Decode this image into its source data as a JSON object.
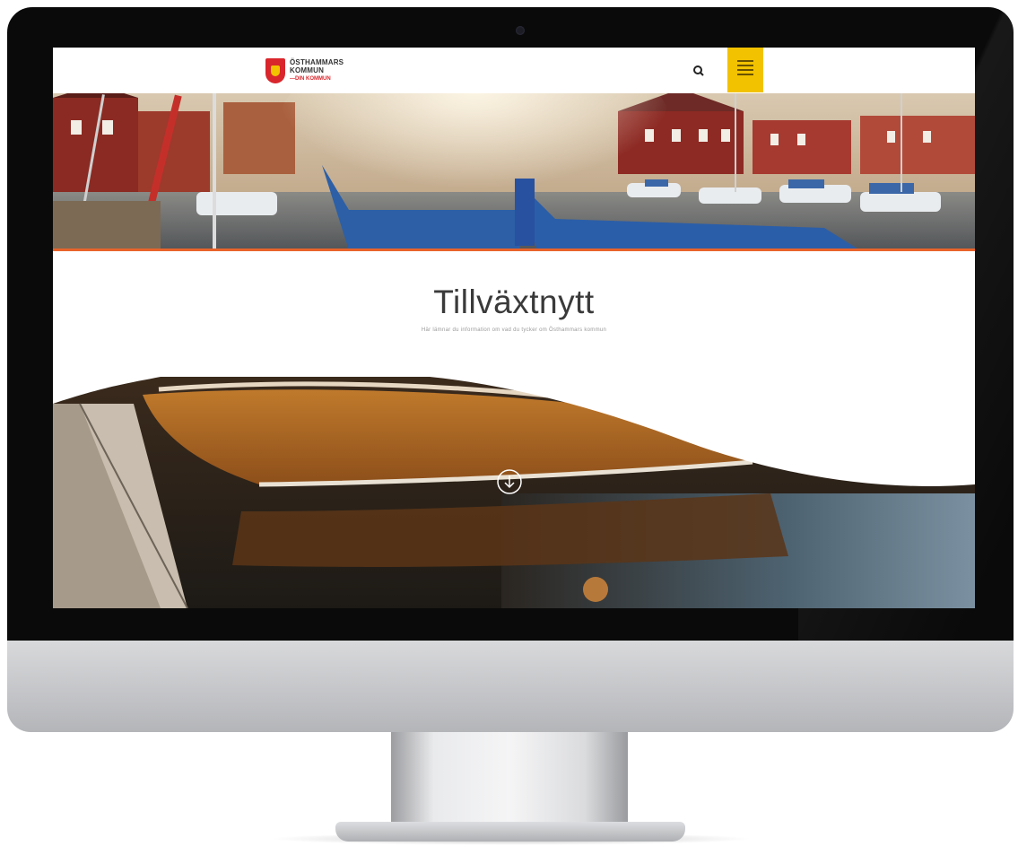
{
  "site": {
    "logo_lines": [
      "ÖSTHAMMARS",
      "KOMMUN"
    ],
    "logo_tagline": "—DIN KOMMUN",
    "title": "Tillväxtnytt",
    "subtitle": "Här lämnar du information om vad du tycker om Östhammars kommun"
  },
  "icons": {
    "search": "search-icon",
    "menu": "hamburger-menu-icon",
    "scroll": "arrow-down-circle-icon",
    "logo": "coat-of-arms-icon"
  },
  "colors": {
    "accent_yellow": "#f2c200",
    "accent_orange": "#e8632a",
    "logo_red": "#d9262c",
    "bezel": "#0a0a0a"
  }
}
